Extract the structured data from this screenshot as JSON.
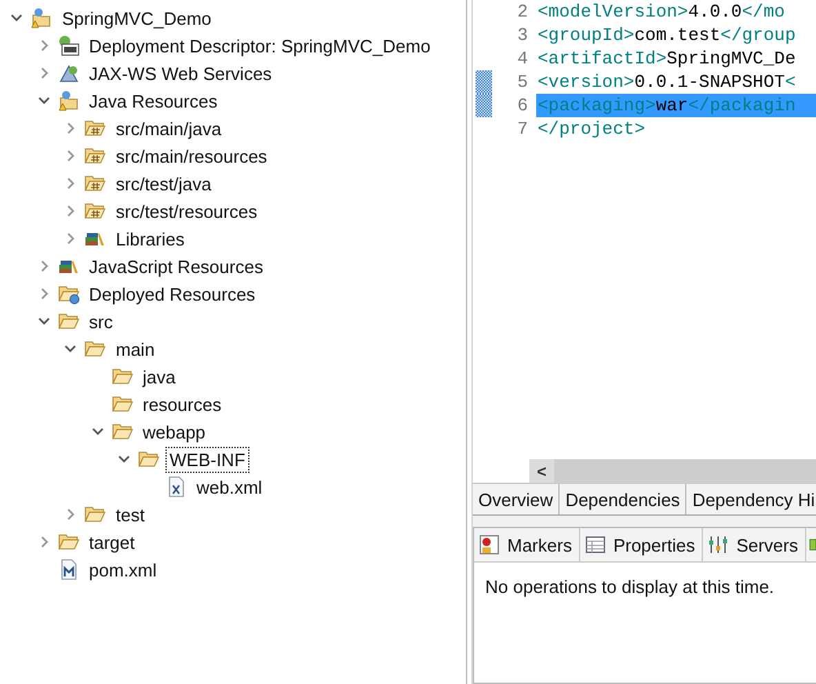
{
  "tree": [
    {
      "label": "SpringMVC_Demo",
      "kind": "project",
      "expanded": true,
      "focused": false,
      "children": [
        {
          "label": "Deployment Descriptor: SpringMVC_Demo",
          "kind": "descriptor",
          "expanded": false,
          "focused": false
        },
        {
          "label": "JAX-WS Web Services",
          "kind": "webservices",
          "expanded": false,
          "focused": false
        },
        {
          "label": "Java Resources",
          "kind": "java-resources",
          "expanded": true,
          "focused": false,
          "children": [
            {
              "label": "src/main/java",
              "kind": "package-folder",
              "expanded": false,
              "focused": false
            },
            {
              "label": "src/main/resources",
              "kind": "package-folder",
              "expanded": false,
              "focused": false
            },
            {
              "label": "src/test/java",
              "kind": "package-folder",
              "expanded": false,
              "focused": false
            },
            {
              "label": "src/test/resources",
              "kind": "package-folder",
              "expanded": false,
              "focused": false
            },
            {
              "label": "Libraries",
              "kind": "libraries",
              "expanded": false,
              "focused": false
            }
          ]
        },
        {
          "label": "JavaScript Resources",
          "kind": "libraries",
          "expanded": false,
          "focused": false
        },
        {
          "label": "Deployed Resources",
          "kind": "deployed",
          "expanded": false,
          "focused": false
        },
        {
          "label": "src",
          "kind": "folder",
          "expanded": true,
          "focused": false,
          "children": [
            {
              "label": "main",
              "kind": "folder",
              "expanded": true,
              "focused": false,
              "children": [
                {
                  "label": "java",
                  "kind": "folder",
                  "focused": false
                },
                {
                  "label": "resources",
                  "kind": "folder",
                  "focused": false
                },
                {
                  "label": "webapp",
                  "kind": "folder",
                  "expanded": true,
                  "focused": false,
                  "children": [
                    {
                      "label": "WEB-INF",
                      "kind": "folder",
                      "expanded": true,
                      "focused": true,
                      "children": [
                        {
                          "label": "web.xml",
                          "kind": "xml-file",
                          "focused": false
                        }
                      ]
                    }
                  ]
                }
              ]
            },
            {
              "label": "test",
              "kind": "folder",
              "expanded": false,
              "focused": false
            }
          ]
        },
        {
          "label": "target",
          "kind": "folder",
          "expanded": false,
          "focused": false
        },
        {
          "label": "pom.xml",
          "kind": "maven-file",
          "focused": false
        }
      ]
    }
  ],
  "editor": {
    "lines": [
      {
        "number": "2",
        "highlighted": false,
        "changed": false,
        "parts": [
          {
            "kind": "tag",
            "text": "  <modelVersion>"
          },
          {
            "kind": "text",
            "text": "4.0.0"
          },
          {
            "kind": "tag",
            "text": "</mo"
          }
        ]
      },
      {
        "number": "3",
        "highlighted": false,
        "changed": false,
        "parts": [
          {
            "kind": "tag",
            "text": "  <groupId>"
          },
          {
            "kind": "text",
            "text": "com.test"
          },
          {
            "kind": "tag",
            "text": "</group"
          }
        ]
      },
      {
        "number": "4",
        "highlighted": false,
        "changed": false,
        "parts": [
          {
            "kind": "tag",
            "text": "  <artifactId>"
          },
          {
            "kind": "text",
            "text": "SpringMVC_De"
          }
        ]
      },
      {
        "number": "5",
        "highlighted": false,
        "changed": true,
        "parts": [
          {
            "kind": "tag",
            "text": "  <version>"
          },
          {
            "kind": "text",
            "text": "0.0.1-SNAPSHOT"
          },
          {
            "kind": "tag",
            "text": "<"
          }
        ]
      },
      {
        "number": "6",
        "highlighted": true,
        "changed": true,
        "parts": [
          {
            "kind": "tag",
            "text": "  <packaging>"
          },
          {
            "kind": "text",
            "text": "war"
          },
          {
            "kind": "tag",
            "text": "</packagin"
          }
        ]
      },
      {
        "number": "7",
        "highlighted": false,
        "changed": false,
        "parts": [
          {
            "kind": "tag",
            "text": "</project>"
          }
        ]
      }
    ],
    "scroll_left": "<",
    "tabs": [
      {
        "label": "Overview",
        "selected": false
      },
      {
        "label": "Dependencies",
        "selected": false
      },
      {
        "label": "Dependency Hi",
        "selected": false
      }
    ]
  },
  "bottom_panel": {
    "tabs": [
      {
        "label": "Markers",
        "kind": "markers",
        "selected": false
      },
      {
        "label": "Properties",
        "kind": "properties",
        "selected": false
      },
      {
        "label": "Servers",
        "kind": "servers",
        "selected": false
      }
    ],
    "message": "No operations to display at this time."
  }
}
